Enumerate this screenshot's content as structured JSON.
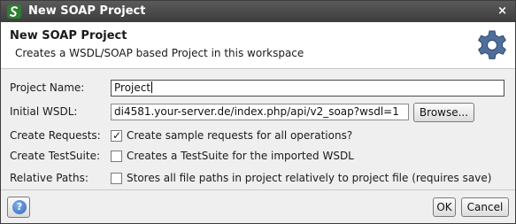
{
  "window": {
    "title": "New SOAP Project",
    "close_glyph": "×",
    "app_icon": "soapui-logo-icon"
  },
  "header": {
    "title": "New SOAP Project",
    "description": "Creates a WSDL/SOAP based Project in this workspace",
    "icon": "gear-icon"
  },
  "form": {
    "project_name": {
      "label": "Project Name:",
      "value": "Project"
    },
    "initial_wsdl": {
      "label": "Initial WSDL:",
      "value": "di4581.your-server.de/index.php/api/v2_soap?wsdl=1",
      "browse_label": "Browse..."
    },
    "create_requests": {
      "label": "Create Requests:",
      "checkbox_label": "Create sample requests for all operations?",
      "checked": true
    },
    "create_testsuite": {
      "label": "Create TestSuite:",
      "checkbox_label": "Creates a TestSuite for the imported WSDL",
      "checked": false
    },
    "relative_paths": {
      "label": "Relative Paths:",
      "checkbox_label": "Stores all file paths in project relatively to project file (requires save)",
      "checked": false
    }
  },
  "footer": {
    "help_icon": "help-icon",
    "ok_label": "OK",
    "cancel_label": "Cancel"
  },
  "colors": {
    "titlebar": "#3d3d3d",
    "dialog_bg": "#efefef",
    "help_blue": "#2f66b8"
  }
}
